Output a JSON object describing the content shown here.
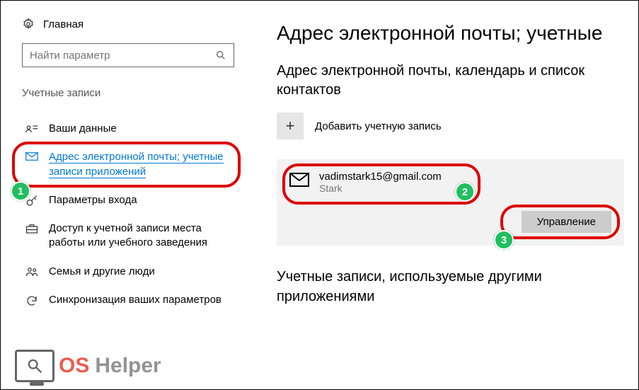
{
  "sidebar": {
    "home": "Главная",
    "search_placeholder": "Найти параметр",
    "section": "Учетные записи",
    "items": [
      {
        "label": "Ваши данные"
      },
      {
        "label": "Адрес электронной почты; учетные записи приложений"
      },
      {
        "label": "Параметры входа"
      },
      {
        "label": "Доступ к учетной записи места работы или учебного заведения"
      },
      {
        "label": "Семья и другие люди"
      },
      {
        "label": "Синхронизация ваших параметров"
      }
    ]
  },
  "main": {
    "title": "Адрес электронной почты; учетные",
    "subtitle": "Адрес электронной почты, календарь и список контактов",
    "add_account": "Добавить учетную запись",
    "account": {
      "email": "vadimstark15@gmail.com",
      "name": "Stark"
    },
    "manage": "Управление",
    "section2": "Учетные записи, используемые другими приложениями"
  },
  "annotations": {
    "b1": "1",
    "b2": "2",
    "b3": "3"
  },
  "watermark": {
    "os": "OS",
    "helper": "Helper"
  }
}
